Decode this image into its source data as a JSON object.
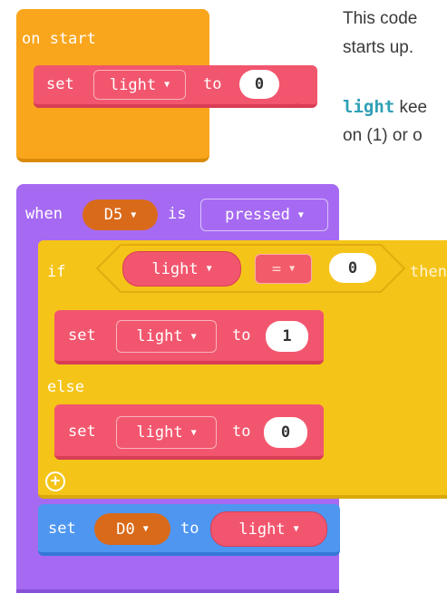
{
  "colors": {
    "orange_block": "#f9a61c",
    "orange_block_dark": "#d98a08",
    "pink_block": "#f2566e",
    "pink_block_dark": "#d93d56",
    "purple_block": "#a66af2",
    "purple_block_dark": "#8650d8",
    "yellow_block": "#f5c418",
    "yellow_block_dark": "#d9a90a",
    "blue_block": "#4e96f0",
    "blue_block_dark": "#3478d6",
    "pin_orange": "#d96a1a",
    "var_teal": "#2fa0b5"
  },
  "description": {
    "line1": "This code",
    "line2": "starts up.",
    "line3_var": "light",
    "line3_rest": " kee",
    "line4": "on (1) or o"
  },
  "on_start": {
    "label": "on start",
    "set_block": {
      "keyword": "set",
      "variable": "light",
      "to": "to",
      "value": "0"
    }
  },
  "when_block": {
    "when": "when",
    "pin": "D5",
    "is": "is",
    "event": "pressed",
    "if_block": {
      "if": "if",
      "left_operand": "light",
      "operator": "=",
      "right_operand": "0",
      "then": "then"
    },
    "then_set": {
      "keyword": "set",
      "variable": "light",
      "to": "to",
      "value": "1"
    },
    "else": "else",
    "else_set": {
      "keyword": "set",
      "variable": "light",
      "to": "to",
      "value": "0"
    },
    "add_icon": "plus-circle-icon",
    "write_pin": {
      "keyword": "set",
      "pin": "D0",
      "to": "to",
      "value": "light"
    }
  },
  "dropdown_icon": "caret-down-icon"
}
